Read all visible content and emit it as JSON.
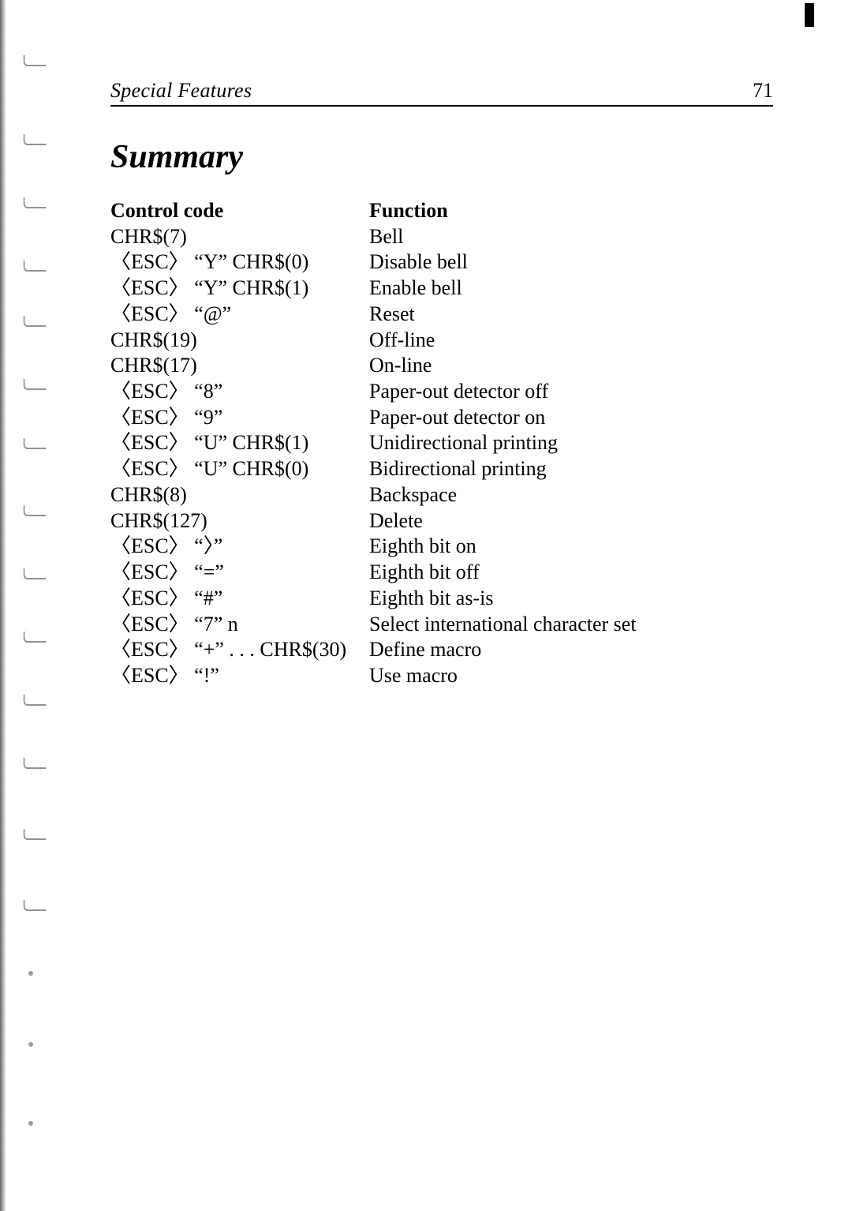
{
  "header": {
    "section": "Special Features",
    "page_number": "71"
  },
  "title": "Summary",
  "columns": {
    "code_header": "Control code",
    "func_header": "Function"
  },
  "rows": [
    {
      "code": "CHR$(7)",
      "func": "Bell"
    },
    {
      "code": "〈ESC〉 “Y” CHR$(0)",
      "func": "Disable bell"
    },
    {
      "code": "〈ESC〉 “Y” CHR$(1)",
      "func": "Enable bell"
    },
    {
      "code": "〈ESC〉 “@”",
      "func": "Reset"
    },
    {
      "code": "CHR$(19)",
      "func": "Off-line"
    },
    {
      "code": "CHR$(17)",
      "func": "On-line"
    },
    {
      "code": "〈ESC〉 “8”",
      "func": "Paper-out detector off"
    },
    {
      "code": "〈ESC〉 “9”",
      "func": "Paper-out detector on"
    },
    {
      "code": "〈ESC〉 “U” CHR$(1)",
      "func": "Unidirectional printing"
    },
    {
      "code": "〈ESC〉 “U” CHR$(0)",
      "func": "Bidirectional printing"
    },
    {
      "code": "CHR$(8)",
      "func": "Backspace"
    },
    {
      "code": "CHR$(127)",
      "func": "Delete"
    },
    {
      "code": "〈ESC〉 “〉”",
      "func": "Eighth bit on"
    },
    {
      "code": "〈ESC〉 “=”",
      "func": "Eighth bit off"
    },
    {
      "code": "〈ESC〉 “#”",
      "func": "Eighth bit as-is"
    },
    {
      "code": "〈ESC〉 “7” n",
      "func": "Select international character set"
    },
    {
      "code": "〈ESC〉 “+” . . . CHR$(30)",
      "func": "Define macro"
    },
    {
      "code": "〈ESC〉 “!”",
      "func": "Use macro"
    }
  ]
}
